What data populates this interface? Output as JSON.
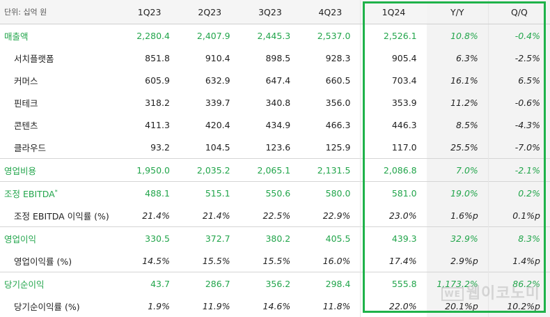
{
  "header": {
    "unit_label": "단위: 십억 원",
    "columns": [
      "1Q23",
      "2Q23",
      "3Q23",
      "4Q23",
      "1Q24",
      "Y/Y",
      "Q/Q"
    ]
  },
  "rows": [
    {
      "label": "매출액",
      "major": true,
      "values": [
        "2,280.4",
        "2,407.9",
        "2,445.3",
        "2,537.0",
        "2,526.1",
        "10.8%",
        "-0.4%"
      ]
    },
    {
      "label": "서치플랫폼",
      "values": [
        "851.8",
        "910.4",
        "898.5",
        "928.3",
        "905.4",
        "6.3%",
        "-2.5%"
      ]
    },
    {
      "label": "커머스",
      "values": [
        "605.9",
        "632.9",
        "647.4",
        "660.5",
        "703.4",
        "16.1%",
        "6.5%"
      ]
    },
    {
      "label": "핀테크",
      "values": [
        "318.2",
        "339.7",
        "340.8",
        "356.0",
        "353.9",
        "11.2%",
        "-0.6%"
      ]
    },
    {
      "label": "콘텐츠",
      "values": [
        "411.3",
        "420.4",
        "434.9",
        "466.3",
        "446.3",
        "8.5%",
        "-4.3%"
      ]
    },
    {
      "label": "클라우드",
      "values": [
        "93.2",
        "104.5",
        "123.6",
        "125.9",
        "117.0",
        "25.5%",
        "-7.0%"
      ]
    },
    {
      "label": "영업비용",
      "major": true,
      "values": [
        "1,950.0",
        "2,035.2",
        "2,065.1",
        "2,131.5",
        "2,086.8",
        "7.0%",
        "-2.1%"
      ]
    },
    {
      "label": "조정 EBITDA",
      "sup": "*",
      "major": true,
      "values": [
        "488.1",
        "515.1",
        "550.6",
        "580.0",
        "581.0",
        "19.0%",
        "0.2%"
      ]
    },
    {
      "label": "조정 EBITDA 이익률 (%)",
      "ratio": true,
      "values": [
        "21.4%",
        "21.4%",
        "22.5%",
        "22.9%",
        "23.0%",
        "1.6%p",
        "0.1%p"
      ]
    },
    {
      "label": "영업이익",
      "major": true,
      "values": [
        "330.5",
        "372.7",
        "380.2",
        "405.5",
        "439.3",
        "32.9%",
        "8.3%"
      ]
    },
    {
      "label": "영업이익률 (%)",
      "ratio": true,
      "values": [
        "14.5%",
        "15.5%",
        "15.5%",
        "16.0%",
        "17.4%",
        "2.9%p",
        "1.4%p"
      ]
    },
    {
      "label": "당기순이익",
      "major": true,
      "values": [
        "43.7",
        "286.7",
        "356.2",
        "298.4",
        "555.8",
        "1,173.2%",
        "86.2%"
      ]
    },
    {
      "label": "당기순이익률 (%)",
      "ratio": true,
      "values": [
        "1.9%",
        "11.9%",
        "14.6%",
        "11.8%",
        "22.0%",
        "20.1%p",
        "10.2%p"
      ]
    }
  ],
  "watermark": {
    "badge": "WE",
    "text": "웹이코노미"
  },
  "colors": {
    "accent": "#22a54b",
    "frame": "#1fb24a",
    "header_bg": "#f5f5f5",
    "shade": "#f3f3f3"
  }
}
